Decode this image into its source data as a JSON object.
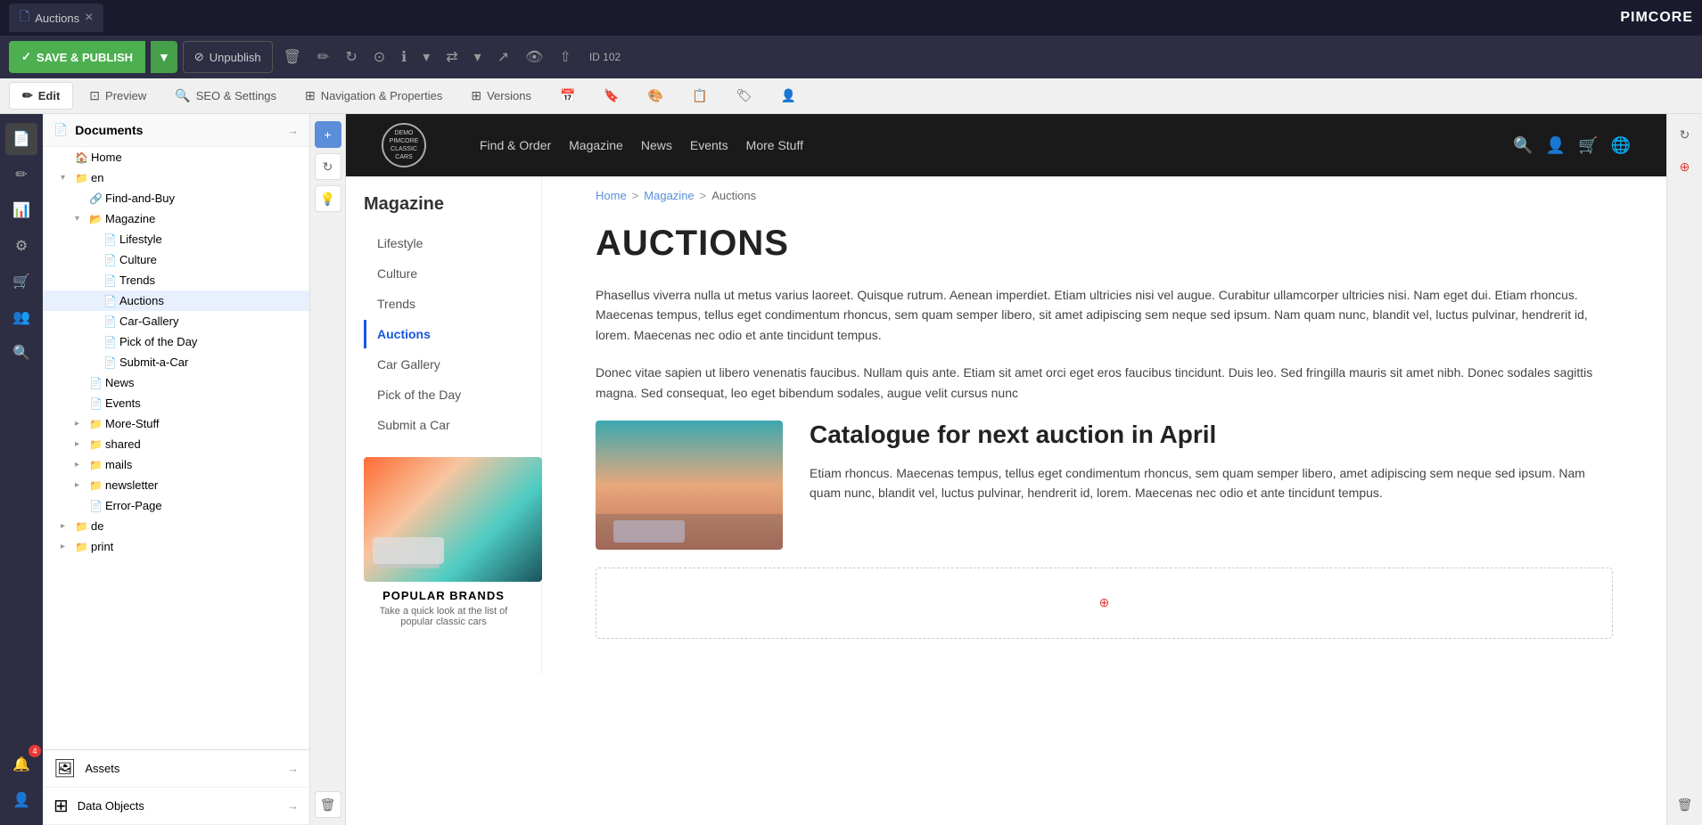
{
  "app": {
    "name": "PIMCORE",
    "tab_title": "Auctions",
    "tab_id": "ID 102"
  },
  "toolbar": {
    "save_publish": "SAVE & PUBLISH",
    "unpublish": "Unpublish",
    "edit_tab": "Edit",
    "preview_tab": "Preview",
    "seo_tab": "SEO & Settings",
    "nav_tab": "Navigation & Properties",
    "versions_tab": "Versions"
  },
  "sidebar": {
    "title": "Documents",
    "items": [
      {
        "label": "Home",
        "level": 0,
        "type": "home",
        "id": "home"
      },
      {
        "label": "en",
        "level": 1,
        "type": "folder",
        "id": "en"
      },
      {
        "label": "Find-and-Buy",
        "level": 2,
        "type": "link",
        "id": "find-and-buy"
      },
      {
        "label": "Magazine",
        "level": 2,
        "type": "folder-open",
        "id": "magazine"
      },
      {
        "label": "Lifestyle",
        "level": 3,
        "type": "doc",
        "id": "lifestyle"
      },
      {
        "label": "Culture",
        "level": 3,
        "type": "doc",
        "id": "culture"
      },
      {
        "label": "Trends",
        "level": 3,
        "type": "doc",
        "id": "trends"
      },
      {
        "label": "Auctions",
        "level": 3,
        "type": "doc",
        "id": "auctions",
        "selected": true
      },
      {
        "label": "Car-Gallery",
        "level": 3,
        "type": "doc",
        "id": "car-gallery"
      },
      {
        "label": "Pick of the Day",
        "level": 3,
        "type": "doc",
        "id": "pick-of-the-day"
      },
      {
        "label": "Submit-a-Car",
        "level": 3,
        "type": "doc",
        "id": "submit-a-car"
      },
      {
        "label": "News",
        "level": 2,
        "type": "doc",
        "id": "news"
      },
      {
        "label": "Events",
        "level": 2,
        "type": "doc",
        "id": "events"
      },
      {
        "label": "More-Stuff",
        "level": 2,
        "type": "folder",
        "id": "more-stuff"
      },
      {
        "label": "shared",
        "level": 2,
        "type": "folder",
        "id": "shared"
      },
      {
        "label": "mails",
        "level": 2,
        "type": "folder",
        "id": "mails"
      },
      {
        "label": "newsletter",
        "level": 2,
        "type": "folder",
        "id": "newsletter"
      },
      {
        "label": "Error-Page",
        "level": 2,
        "type": "doc",
        "id": "error-page"
      },
      {
        "label": "de",
        "level": 1,
        "type": "folder",
        "id": "de"
      },
      {
        "label": "print",
        "level": 1,
        "type": "folder",
        "id": "print"
      }
    ]
  },
  "icon_sidebar": {
    "items": [
      {
        "icon": "📄",
        "name": "documents-icon",
        "active": true
      },
      {
        "icon": "✏️",
        "name": "edit-icon"
      },
      {
        "icon": "📊",
        "name": "analytics-icon"
      },
      {
        "icon": "⚙️",
        "name": "settings-icon"
      },
      {
        "icon": "🛒",
        "name": "ecommerce-icon"
      },
      {
        "icon": "👥",
        "name": "users-icon"
      },
      {
        "icon": "🔍",
        "name": "search-icon"
      }
    ],
    "bottom": [
      {
        "icon": "🔔",
        "name": "notifications-icon",
        "badge": "4"
      },
      {
        "icon": "👤",
        "name": "profile-icon"
      }
    ]
  },
  "site": {
    "logo_text": "DEMO\nPIMCORE\nCLASSIC CARS",
    "nav_links": [
      "Find & Order",
      "Magazine",
      "News",
      "Events",
      "More Stuff"
    ],
    "breadcrumb": [
      "Home",
      "Magazine",
      "Auctions"
    ],
    "page_title": "AUCTIONS",
    "paragraph1": "Phasellus viverra nulla ut metus varius laoreet. Quisque rutrum. Aenean imperdiet. Etiam ultricies nisi vel augue. Curabitur ullamcorper ultricies nisi. Nam eget dui. Etiam rhoncus. Maecenas tempus, tellus eget condimentum rhoncus, sem quam semper libero, sit amet adipiscing sem neque sed ipsum. Nam quam nunc, blandit vel, luctus pulvinar, hendrerit id, lorem. Maecenas nec odio et ante tincidunt tempus.",
    "paragraph2": "Donec vitae sapien ut libero venenatis faucibus. Nullam quis ante. Etiam sit amet orci eget eros faucibus tincidunt. Duis leo. Sed fringilla mauris sit amet nibh. Donec sodales sagittis magna. Sed consequat, leo eget bibendum sodales, augue velit cursus nunc",
    "section_title": "Catalogue for next auction in April",
    "paragraph3": "Etiam rhoncus. Maecenas tempus, tellus eget condimentum rhoncus, sem quam semper libero, amet adipiscing sem neque sed ipsum. Nam quam nunc, blandit vel, luctus pulvinar, hendrerit id, lorem. Maecenas nec odio et ante tincidunt tempus.",
    "magazine_nav": {
      "title": "Magazine",
      "items": [
        "Lifestyle",
        "Culture",
        "Trends",
        "Auctions",
        "Car Gallery",
        "Pick of the Day",
        "Submit a Car"
      ]
    },
    "card": {
      "title": "POPULAR BRANDS",
      "desc": "Take a quick look at the list of popular classic cars"
    }
  },
  "assets_label": "Assets",
  "data_objects_label": "Data Objects"
}
